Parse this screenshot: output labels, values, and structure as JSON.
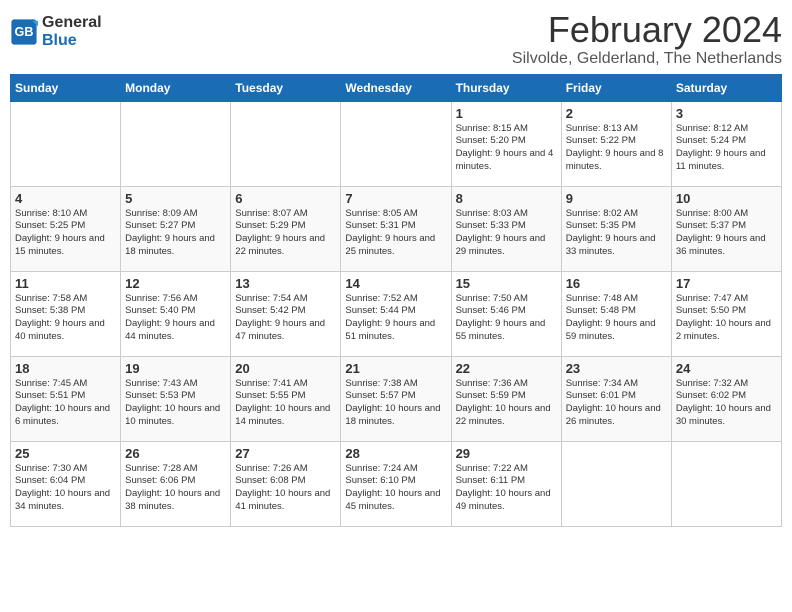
{
  "header": {
    "logo_line1": "General",
    "logo_line2": "Blue",
    "title": "February 2024",
    "subtitle": "Silvolde, Gelderland, The Netherlands"
  },
  "days_of_week": [
    "Sunday",
    "Monday",
    "Tuesday",
    "Wednesday",
    "Thursday",
    "Friday",
    "Saturday"
  ],
  "weeks": [
    [
      {
        "day": "",
        "text": ""
      },
      {
        "day": "",
        "text": ""
      },
      {
        "day": "",
        "text": ""
      },
      {
        "day": "",
        "text": ""
      },
      {
        "day": "1",
        "text": "Sunrise: 8:15 AM\nSunset: 5:20 PM\nDaylight: 9 hours and 4 minutes."
      },
      {
        "day": "2",
        "text": "Sunrise: 8:13 AM\nSunset: 5:22 PM\nDaylight: 9 hours and 8 minutes."
      },
      {
        "day": "3",
        "text": "Sunrise: 8:12 AM\nSunset: 5:24 PM\nDaylight: 9 hours and 11 minutes."
      }
    ],
    [
      {
        "day": "4",
        "text": "Sunrise: 8:10 AM\nSunset: 5:25 PM\nDaylight: 9 hours and 15 minutes."
      },
      {
        "day": "5",
        "text": "Sunrise: 8:09 AM\nSunset: 5:27 PM\nDaylight: 9 hours and 18 minutes."
      },
      {
        "day": "6",
        "text": "Sunrise: 8:07 AM\nSunset: 5:29 PM\nDaylight: 9 hours and 22 minutes."
      },
      {
        "day": "7",
        "text": "Sunrise: 8:05 AM\nSunset: 5:31 PM\nDaylight: 9 hours and 25 minutes."
      },
      {
        "day": "8",
        "text": "Sunrise: 8:03 AM\nSunset: 5:33 PM\nDaylight: 9 hours and 29 minutes."
      },
      {
        "day": "9",
        "text": "Sunrise: 8:02 AM\nSunset: 5:35 PM\nDaylight: 9 hours and 33 minutes."
      },
      {
        "day": "10",
        "text": "Sunrise: 8:00 AM\nSunset: 5:37 PM\nDaylight: 9 hours and 36 minutes."
      }
    ],
    [
      {
        "day": "11",
        "text": "Sunrise: 7:58 AM\nSunset: 5:38 PM\nDaylight: 9 hours and 40 minutes."
      },
      {
        "day": "12",
        "text": "Sunrise: 7:56 AM\nSunset: 5:40 PM\nDaylight: 9 hours and 44 minutes."
      },
      {
        "day": "13",
        "text": "Sunrise: 7:54 AM\nSunset: 5:42 PM\nDaylight: 9 hours and 47 minutes."
      },
      {
        "day": "14",
        "text": "Sunrise: 7:52 AM\nSunset: 5:44 PM\nDaylight: 9 hours and 51 minutes."
      },
      {
        "day": "15",
        "text": "Sunrise: 7:50 AM\nSunset: 5:46 PM\nDaylight: 9 hours and 55 minutes."
      },
      {
        "day": "16",
        "text": "Sunrise: 7:48 AM\nSunset: 5:48 PM\nDaylight: 9 hours and 59 minutes."
      },
      {
        "day": "17",
        "text": "Sunrise: 7:47 AM\nSunset: 5:50 PM\nDaylight: 10 hours and 2 minutes."
      }
    ],
    [
      {
        "day": "18",
        "text": "Sunrise: 7:45 AM\nSunset: 5:51 PM\nDaylight: 10 hours and 6 minutes."
      },
      {
        "day": "19",
        "text": "Sunrise: 7:43 AM\nSunset: 5:53 PM\nDaylight: 10 hours and 10 minutes."
      },
      {
        "day": "20",
        "text": "Sunrise: 7:41 AM\nSunset: 5:55 PM\nDaylight: 10 hours and 14 minutes."
      },
      {
        "day": "21",
        "text": "Sunrise: 7:38 AM\nSunset: 5:57 PM\nDaylight: 10 hours and 18 minutes."
      },
      {
        "day": "22",
        "text": "Sunrise: 7:36 AM\nSunset: 5:59 PM\nDaylight: 10 hours and 22 minutes."
      },
      {
        "day": "23",
        "text": "Sunrise: 7:34 AM\nSunset: 6:01 PM\nDaylight: 10 hours and 26 minutes."
      },
      {
        "day": "24",
        "text": "Sunrise: 7:32 AM\nSunset: 6:02 PM\nDaylight: 10 hours and 30 minutes."
      }
    ],
    [
      {
        "day": "25",
        "text": "Sunrise: 7:30 AM\nSunset: 6:04 PM\nDaylight: 10 hours and 34 minutes."
      },
      {
        "day": "26",
        "text": "Sunrise: 7:28 AM\nSunset: 6:06 PM\nDaylight: 10 hours and 38 minutes."
      },
      {
        "day": "27",
        "text": "Sunrise: 7:26 AM\nSunset: 6:08 PM\nDaylight: 10 hours and 41 minutes."
      },
      {
        "day": "28",
        "text": "Sunrise: 7:24 AM\nSunset: 6:10 PM\nDaylight: 10 hours and 45 minutes."
      },
      {
        "day": "29",
        "text": "Sunrise: 7:22 AM\nSunset: 6:11 PM\nDaylight: 10 hours and 49 minutes."
      },
      {
        "day": "",
        "text": ""
      },
      {
        "day": "",
        "text": ""
      }
    ]
  ]
}
